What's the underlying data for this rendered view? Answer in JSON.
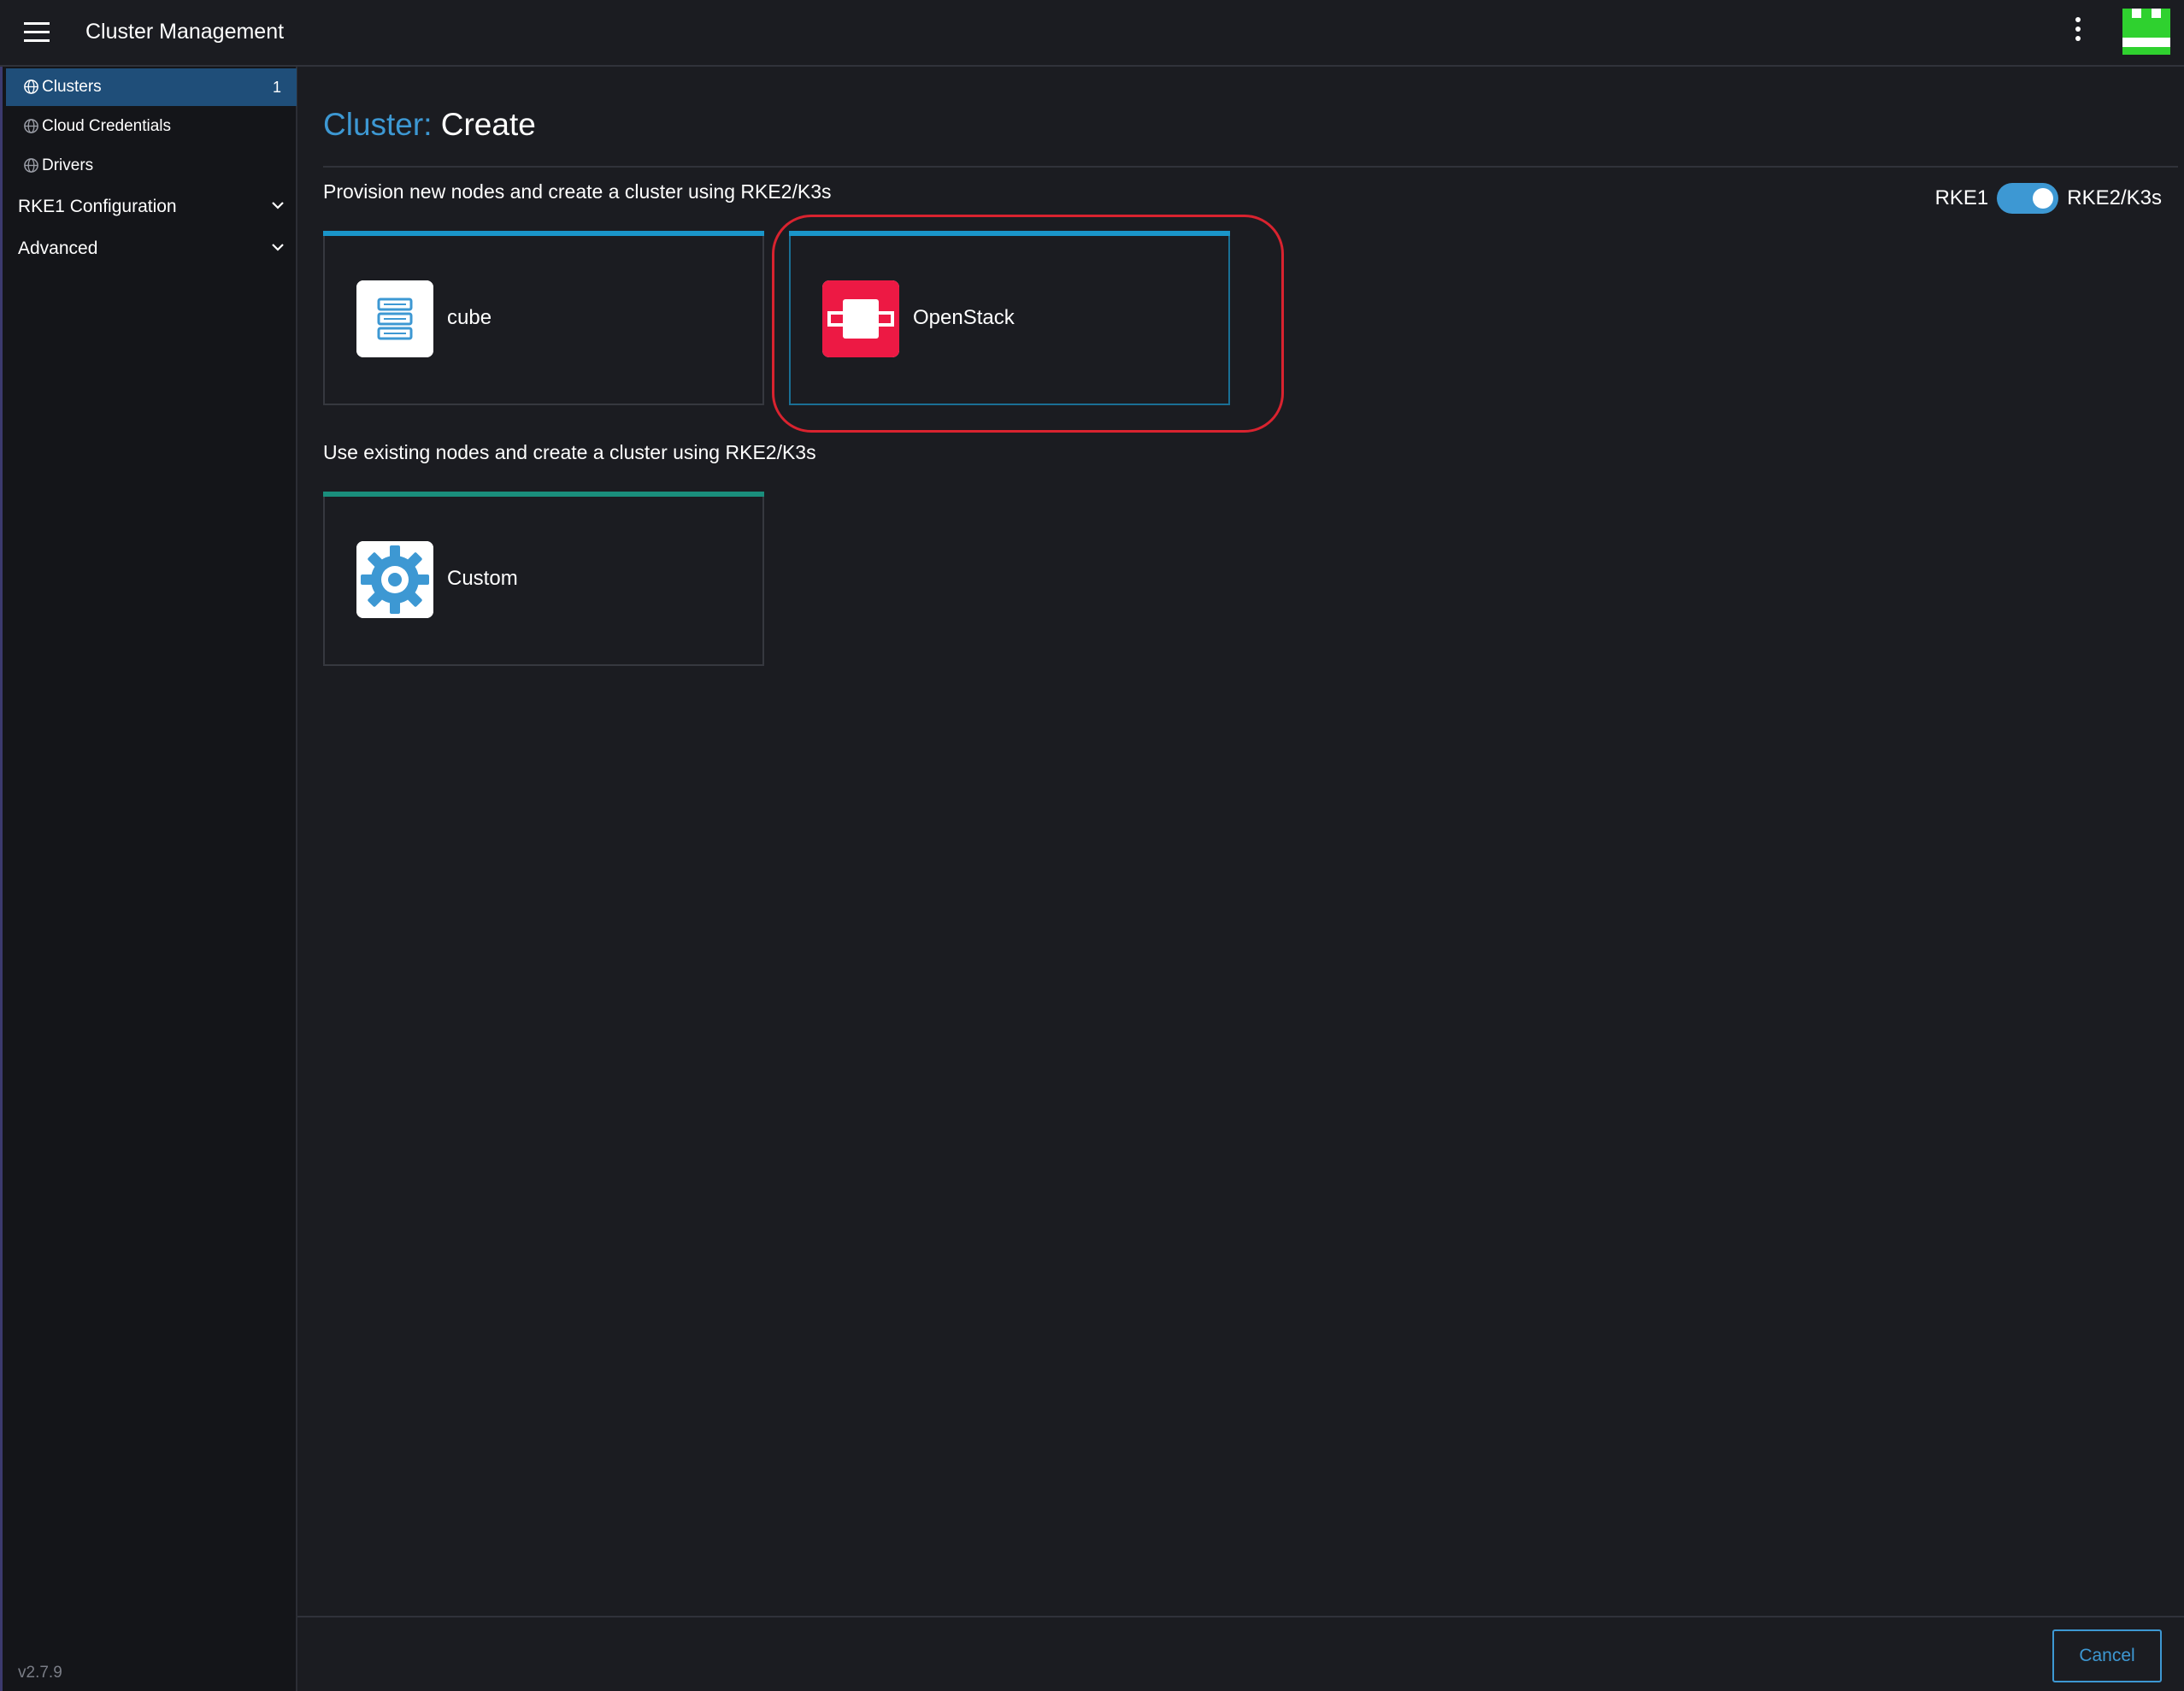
{
  "header": {
    "title": "Cluster Management",
    "menu_icon": "hamburger-menu-icon",
    "more_icon": "kebab-vertical-icon"
  },
  "sidebar": {
    "items": [
      {
        "label": "Clusters",
        "count": "1",
        "icon": "globe-icon",
        "active": true
      },
      {
        "label": "Cloud Credentials",
        "icon": "globe-icon",
        "active": false
      },
      {
        "label": "Drivers",
        "icon": "globe-icon",
        "active": false
      }
    ],
    "groups": [
      {
        "label": "RKE1 Configuration",
        "icon": "chevron-down-icon"
      },
      {
        "label": "Advanced",
        "icon": "chevron-down-icon"
      }
    ],
    "version": "v2.7.9"
  },
  "page": {
    "title_crumb": "Cluster:",
    "title_action": "Create",
    "toggle": {
      "left_label": "RKE1",
      "right_label": "RKE2/K3s",
      "selected": "RKE2/K3s"
    },
    "sections": [
      {
        "label": "Provision new nodes and create a cluster using RKE2/K3s",
        "cards": [
          {
            "name": "cube",
            "icon": "server-stack-icon"
          },
          {
            "name": "OpenStack",
            "icon": "openstack-logo-icon"
          }
        ]
      },
      {
        "label": "Use existing nodes and create a cluster using RKE2/K3s",
        "cards": [
          {
            "name": "Custom",
            "icon": "gear-icon"
          }
        ]
      }
    ],
    "cancel_label": "Cancel"
  },
  "colors": {
    "background": "#1b1c21",
    "sidebar": "#141519",
    "active_nav": "#1f4e79",
    "accent": "#3d98d3",
    "card_bar_provision": "#1a95c9",
    "card_bar_custom": "#1a8e7c",
    "highlight": "#d9232f",
    "openstack_red": "#ed1944"
  }
}
